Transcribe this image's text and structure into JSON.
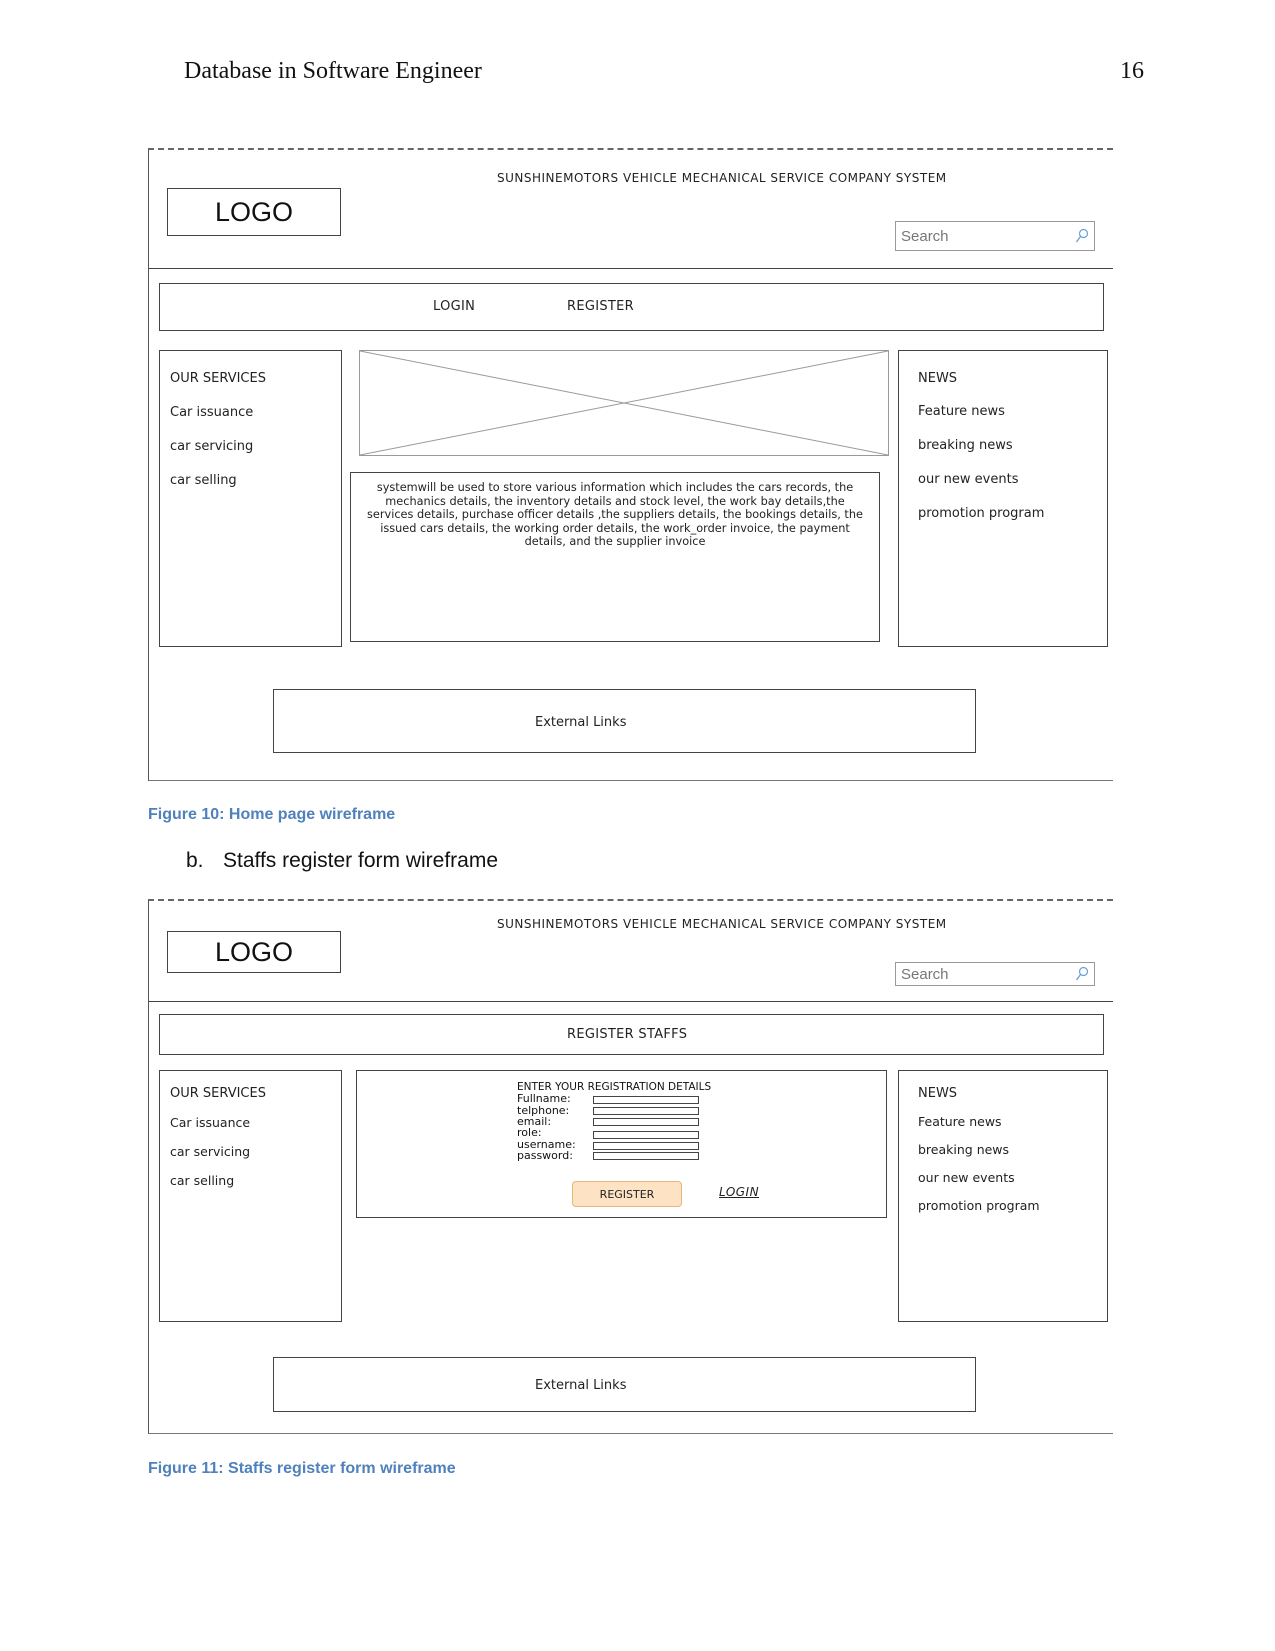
{
  "page": {
    "running_head": "Database in Software Engineer",
    "page_number": "16"
  },
  "figure10": {
    "caption": "Figure 10: Home page wireframe",
    "system_title": "SUNSHINEMOTORS VEHICLE MECHANICAL SERVICE COMPANY SYSTEM",
    "logo": "LOGO",
    "search_placeholder": "Search",
    "nav": [
      "LOGIN",
      "REGISTER"
    ],
    "services": {
      "heading": "OUR SERVICES",
      "items": [
        "Car issuance",
        "car servicing",
        "car selling"
      ]
    },
    "description": "systemwill be used to store various information which includes the cars records, the mechanics details, the inventory details and stock level, the work bay details,the services details, purchase officer details ,the suppliers details, the bookings details, the issued cars details, the working order details, the work_order invoice, the payment details, and the supplier invoice",
    "description_lines": [
      "systemwill be used to store various information which includes the cars records, the",
      "mechanics details, the inventory details and stock level, the work bay details,the",
      "services details, purchase officer details ,the suppliers details, the bookings details, the",
      "issued cars details, the working order details, the work_order invoice, the payment",
      "details, and the supplier invoice"
    ],
    "news": {
      "heading": "NEWS",
      "items": [
        "Feature news",
        "breaking news",
        "our new events",
        "promotion program"
      ]
    },
    "footer": "External Links"
  },
  "section_b": {
    "number": "b.",
    "title": "Staffs register form wireframe"
  },
  "figure11": {
    "caption": "Figure 11: Staffs register form wireframe",
    "system_title": "SUNSHINEMOTORS VEHICLE MECHANICAL SERVICE COMPANY SYSTEM",
    "logo": "LOGO",
    "search_placeholder": "Search",
    "nav_title": "REGISTER STAFFS",
    "services": {
      "heading": "OUR SERVICES",
      "items": [
        "Car issuance",
        "car servicing",
        "car selling"
      ]
    },
    "form": {
      "heading": "ENTER YOUR REGISTRATION DETAILS",
      "fields": [
        {
          "label": "Fullname:",
          "value": ""
        },
        {
          "label": "telphone:",
          "value": ""
        },
        {
          "label": "email:",
          "value": ""
        },
        {
          "label": "role:",
          "value": ""
        },
        {
          "label": "username:",
          "value": ""
        },
        {
          "label": "password:",
          "value": ""
        }
      ],
      "register_button": "REGISTER",
      "login_link": "LOGIN"
    },
    "news": {
      "heading": "NEWS",
      "items": [
        "Feature news",
        "breaking news",
        "our new events",
        "promotion program"
      ]
    },
    "footer": "External Links"
  },
  "colors": {
    "caption": "#4f81bd",
    "register_button_fill": "#fde3c4"
  }
}
